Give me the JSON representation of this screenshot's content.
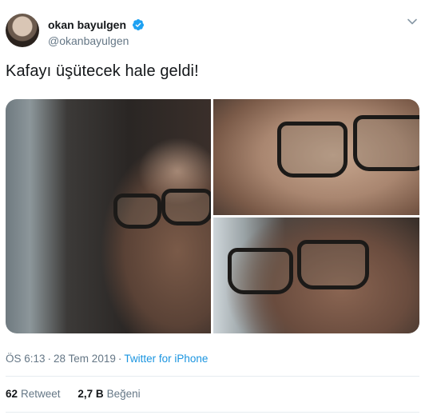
{
  "user": {
    "display_name": "okan bayulgen",
    "handle": "@okanbayulgen",
    "verified_icon": "verified-badge-icon",
    "verified_color": "#1da1f2"
  },
  "tweet": {
    "text": "Kafayı üşütecek hale geldi!"
  },
  "meta": {
    "time": "ÖS 6:13",
    "separator1": "·",
    "date": "28 Tem 2019",
    "separator2": "·",
    "source": "Twitter for iPhone"
  },
  "stats": {
    "retweets_count": "62",
    "retweets_label": "Retweet",
    "likes_count": "2,7 B",
    "likes_label": "Beğeni"
  },
  "colors": {
    "link": "#1b95e0",
    "secondary_text": "#657786"
  }
}
